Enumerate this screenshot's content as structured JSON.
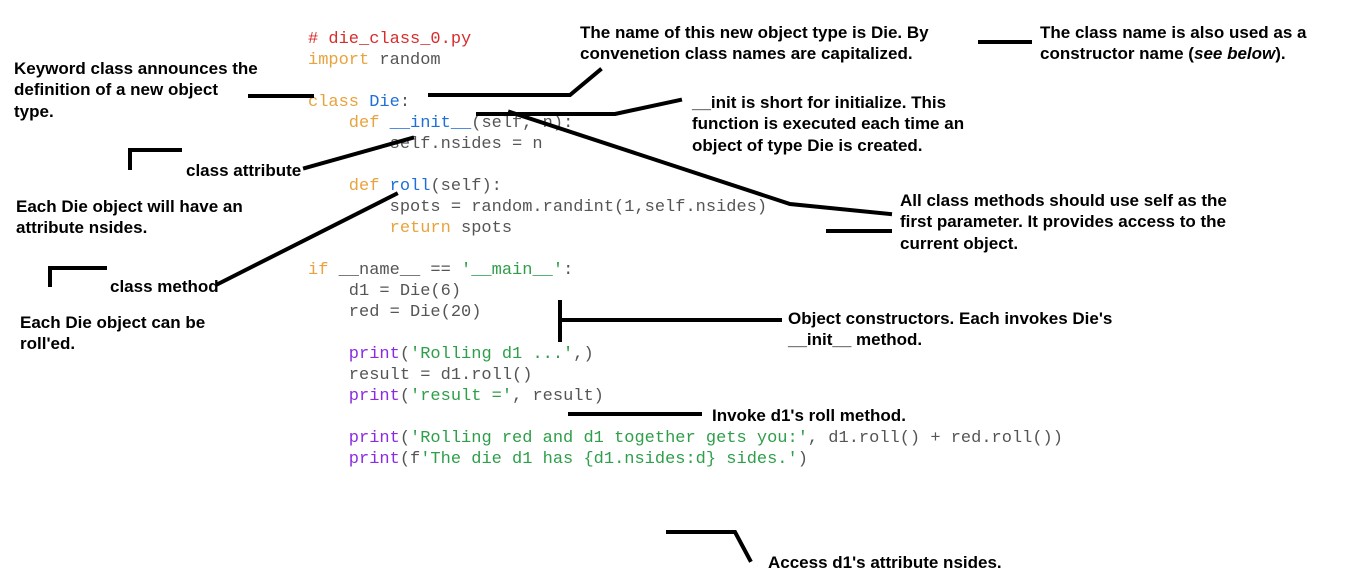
{
  "code": {
    "l1a": "# die_class_0.py",
    "l2a": "import",
    "l2b": " random",
    "l3a": "class",
    "l3b": " Die",
    "l3c": ":",
    "l4a": "    def",
    "l4b": " __init__",
    "l4c": "(self, n):",
    "l5": "        self.nsides = n",
    "l6a": "    def",
    "l6b": " roll",
    "l6c": "(self):",
    "l7": "        spots = random.randint(1,self.nsides)",
    "l8a": "        return",
    "l8b": " spots",
    "l9a": "if",
    "l9b": " __name__ == ",
    "l9c": "'__main__'",
    "l9d": ":",
    "l10": "    d1 = Die(6)",
    "l11": "    red = Die(20)",
    "l12a": "    print",
    "l12b": "(",
    "l12c": "'Rolling d1 ...'",
    "l12d": ",)",
    "l13": "    result = d1.roll()",
    "l14a": "    print",
    "l14b": "(",
    "l14c": "'result ='",
    "l14d": ", result)",
    "l15a": "    print",
    "l15b": "(",
    "l15c": "'Rolling red and d1 together gets you:'",
    "l15d": ", d1.roll() + red.roll())",
    "l16a": "    print",
    "l16b": "(f",
    "l16c": "'The die d1 has {d1.nsides:d} sides.'",
    "l16d": ")"
  },
  "ann": {
    "classKw1": "Keyword class announces the",
    "classKw2": "definition of a new object",
    "classKw3": "type.",
    "nameDie1": "The name of this new object type is Die. By",
    "nameDie2": "convenetion class names are capitalized.",
    "ctorName1": "The class name is also used as a",
    "ctorName2": "constructor name (",
    "ctorName2i": "see below",
    "ctorName2b": ").",
    "classAttr": "class attribute",
    "nsides1": "Each Die object will have an",
    "nsides2": "attribute nsides.",
    "classMethod": "class method",
    "rolled1": "Each Die object can be",
    "rolled2": "roll'ed.",
    "init1": "__init is short for initialize. This",
    "init2": "function is executed each time an",
    "init3": "object of type Die is created.",
    "self1": "All class methods should use self as the",
    "self2": "first parameter. It provides access to the",
    "self3": "current object.",
    "ctors1": "Object constructors. Each invokes Die's",
    "ctors2": "__init__ method.",
    "invoke": "Invoke d1's roll method.",
    "access": "Access d1's attribute nsides."
  }
}
